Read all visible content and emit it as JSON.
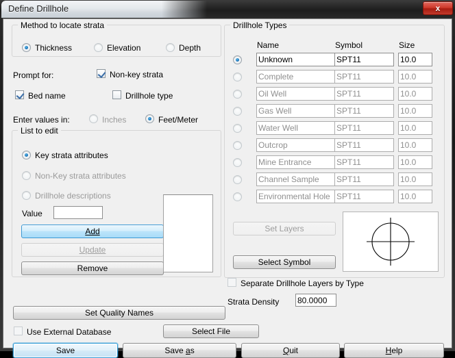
{
  "window": {
    "title": "Define Drillhole",
    "close_icon": "close-icon",
    "close_label": "x"
  },
  "left": {
    "method_group": {
      "legend": "Method to locate strata",
      "options": [
        {
          "label": "Thickness",
          "selected": true
        },
        {
          "label": "Elevation",
          "selected": false
        },
        {
          "label": "Depth",
          "selected": false
        }
      ]
    },
    "prompt_for_label": "Prompt for:",
    "prompt_checks": [
      {
        "label": "Non-key strata",
        "checked": true
      },
      {
        "label": "Bed name",
        "checked": true
      },
      {
        "label": "Drillhole type",
        "checked": false
      }
    ],
    "enter_values_label": "Enter values in:",
    "unit_options": [
      {
        "label": "Inches",
        "selected": false
      },
      {
        "label": "Feet/Meter",
        "selected": true
      }
    ],
    "list_to_edit_group": {
      "legend": "List to edit",
      "options": [
        {
          "label": "Key strata attributes",
          "selected": true
        },
        {
          "label": "Non-Key strata attributes",
          "selected": false
        },
        {
          "label": "Drillhole descriptions",
          "selected": false
        }
      ],
      "value_label": "Value",
      "value_text": "",
      "value_placeholder": "",
      "buttons": [
        {
          "label": "Add",
          "mnemonic": "A",
          "state": "hot"
        },
        {
          "label": "Update",
          "mnemonic": "U",
          "state": "disabled"
        },
        {
          "label": "Remove",
          "mnemonic": "",
          "state": "normal"
        }
      ],
      "list_items": []
    },
    "set_quality_names_label": "Set Quality Names",
    "use_external_database": {
      "label": "Use External Database",
      "checked": false
    },
    "select_file_label": "Select File"
  },
  "right": {
    "types_group": {
      "legend": "Drillhole Types",
      "columns": [
        "Name",
        "Symbol",
        "Size"
      ],
      "rows": [
        {
          "name": "Unknown",
          "symbol": "SPT11",
          "size": "10.0",
          "selected": true,
          "enabled": true
        },
        {
          "name": "Complete",
          "symbol": "SPT11",
          "size": "10.0",
          "selected": false,
          "enabled": false
        },
        {
          "name": "Oil Well",
          "symbol": "SPT11",
          "size": "10.0",
          "selected": false,
          "enabled": false
        },
        {
          "name": "Gas Well",
          "symbol": "SPT11",
          "size": "10.0",
          "selected": false,
          "enabled": false
        },
        {
          "name": "Water Well",
          "symbol": "SPT11",
          "size": "10.0",
          "selected": false,
          "enabled": false
        },
        {
          "name": "Outcrop",
          "symbol": "SPT11",
          "size": "10.0",
          "selected": false,
          "enabled": false
        },
        {
          "name": "Mine Entrance",
          "symbol": "SPT11",
          "size": "10.0",
          "selected": false,
          "enabled": false
        },
        {
          "name": "Channel Sample",
          "symbol": "SPT11",
          "size": "10.0",
          "selected": false,
          "enabled": false
        },
        {
          "name": "Environmental Hole",
          "symbol": "SPT11",
          "size": "10.0",
          "selected": false,
          "enabled": false
        }
      ],
      "set_layers_label": "Set Layers",
      "select_symbol_label": "Select Symbol",
      "symbol_preview_name": "crosshair-circle-symbol"
    },
    "separate_layers": {
      "label": "Separate Drillhole Layers by Type",
      "checked": false
    },
    "strata_density_label": "Strata Density",
    "strata_density_value": "80.0000"
  },
  "footer": {
    "buttons": [
      {
        "label": "Save",
        "mnemonic": "",
        "state": "default"
      },
      {
        "label": "Save as",
        "mnemonic": "a",
        "state": "normal"
      },
      {
        "label": "Quit",
        "mnemonic": "Q",
        "state": "normal"
      },
      {
        "label": "Help",
        "mnemonic": "H",
        "state": "normal"
      }
    ]
  },
  "colors": {
    "dialog_bg": "#f0f0f0",
    "accent_blue": "#1b75bb",
    "close_red": "#c23a2c",
    "disabled_text": "#9a9a9a"
  }
}
